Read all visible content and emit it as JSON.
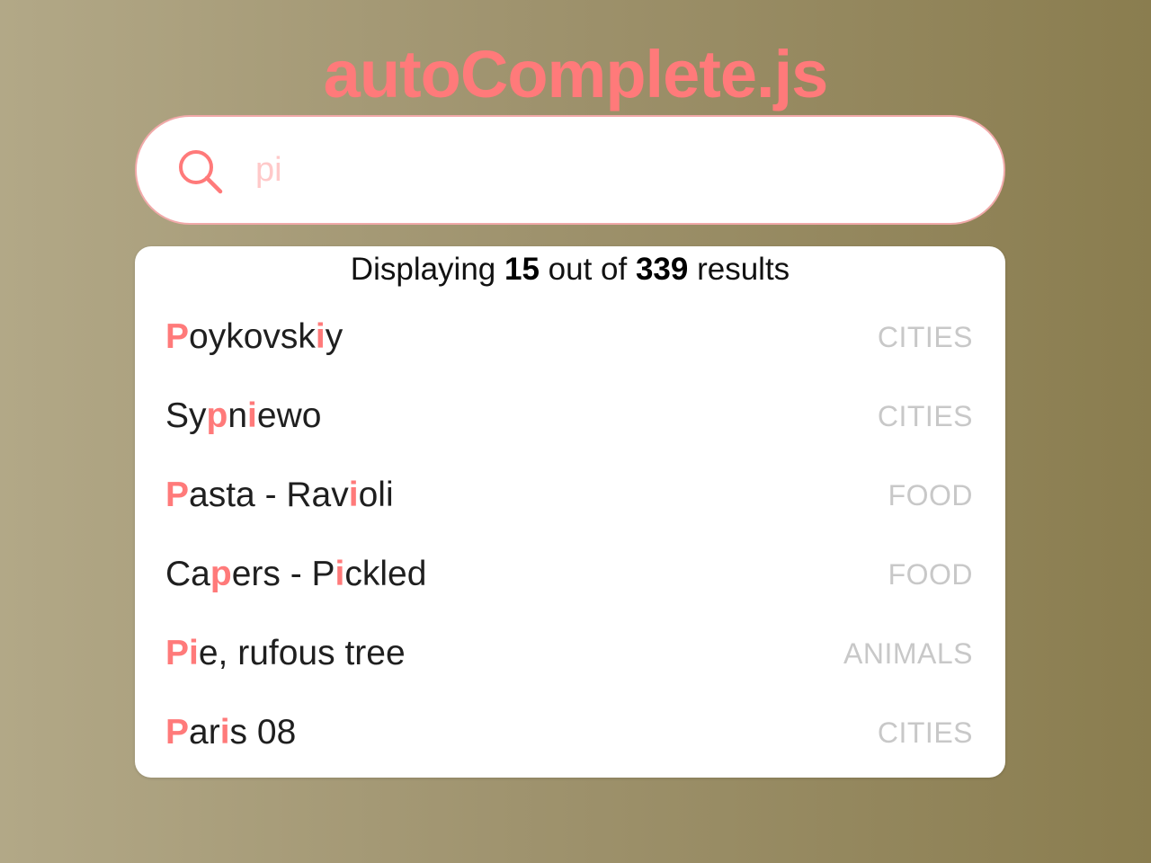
{
  "title": "autoComplete.js",
  "search": {
    "value": "pi"
  },
  "results_info": {
    "prefix": "Displaying ",
    "shown": "15",
    "middle": " out of ",
    "total": "339",
    "suffix": " results"
  },
  "results": [
    {
      "label": "Poykovskiy",
      "segments": [
        {
          "text": "P",
          "hl": true
        },
        {
          "text": "oykovsk",
          "hl": false
        },
        {
          "text": "i",
          "hl": true
        },
        {
          "text": "y",
          "hl": false
        }
      ],
      "category": "CITIES"
    },
    {
      "label": "Sypniewo",
      "segments": [
        {
          "text": "Sy",
          "hl": false
        },
        {
          "text": "p",
          "hl": true
        },
        {
          "text": "n",
          "hl": false
        },
        {
          "text": "i",
          "hl": true
        },
        {
          "text": "ewo",
          "hl": false
        }
      ],
      "category": "CITIES"
    },
    {
      "label": "Pasta - Ravioli",
      "segments": [
        {
          "text": "P",
          "hl": true
        },
        {
          "text": "asta - Rav",
          "hl": false
        },
        {
          "text": "i",
          "hl": true
        },
        {
          "text": "oli",
          "hl": false
        }
      ],
      "category": "FOOD"
    },
    {
      "label": "Capers - Pickled",
      "segments": [
        {
          "text": "Ca",
          "hl": false
        },
        {
          "text": "p",
          "hl": true
        },
        {
          "text": "ers - P",
          "hl": false
        },
        {
          "text": "i",
          "hl": true
        },
        {
          "text": "ckled",
          "hl": false
        }
      ],
      "category": "FOOD"
    },
    {
      "label": "Pie, rufous tree",
      "segments": [
        {
          "text": "Pi",
          "hl": true
        },
        {
          "text": "e, rufous tree",
          "hl": false
        }
      ],
      "category": "ANIMALS"
    },
    {
      "label": "Paris 08",
      "segments": [
        {
          "text": "P",
          "hl": true
        },
        {
          "text": "ar",
          "hl": false
        },
        {
          "text": "i",
          "hl": true
        },
        {
          "text": "s 08",
          "hl": false
        }
      ],
      "category": "CITIES"
    }
  ],
  "colors": {
    "accent": "#ff7a7a",
    "placeholder": "#ffc9c9",
    "category": "#c8c8c8"
  }
}
